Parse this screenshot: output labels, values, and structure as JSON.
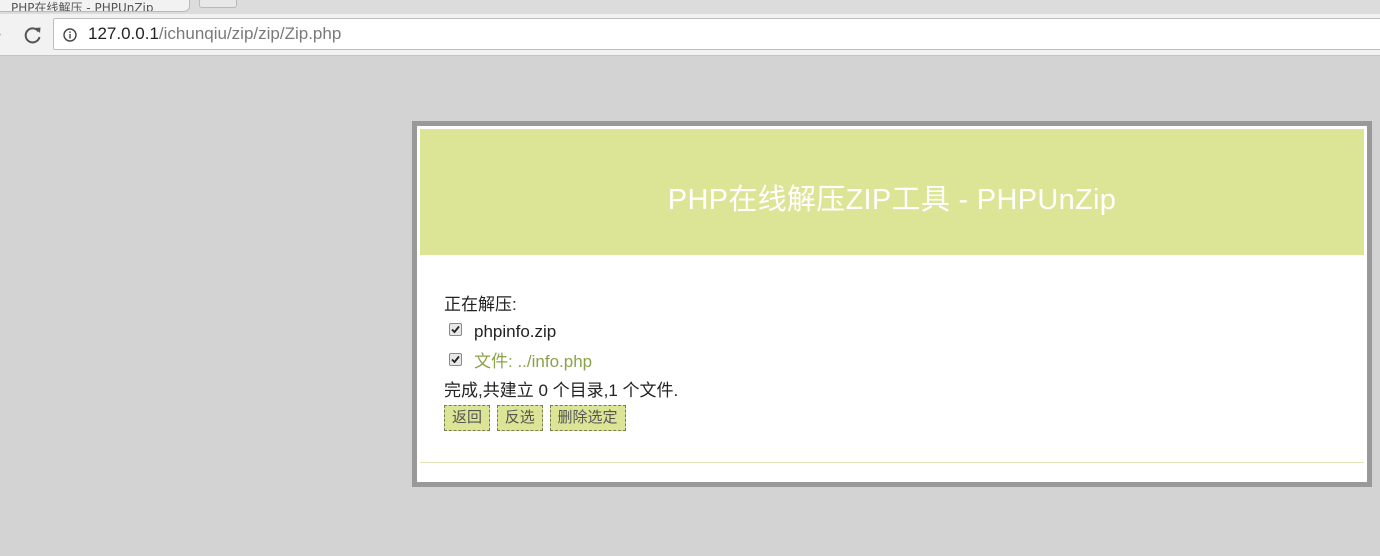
{
  "browser": {
    "tab_title": "PHP在线解压 - PHPUnZip",
    "url_host": "127.0.0.1",
    "url_path": "/ichunqiu/zip/zip/Zip.php"
  },
  "page": {
    "title": "PHP在线解压ZIP工具 - PHPUnZip",
    "status_label": "正在解压:",
    "files": [
      {
        "name": "phpinfo.zip",
        "checked": true
      },
      {
        "name": "文件: ../info.php",
        "checked": true
      }
    ],
    "summary": "完成,共建立 0 个目录,1 个文件.",
    "buttons": {
      "back": "返回",
      "invert": "反选",
      "delete": "删除选定"
    }
  },
  "colors": {
    "header_bg": "#dce496",
    "link": "#8aa34a",
    "panel_border": "#999999",
    "page_bg": "#d3d3d3"
  }
}
